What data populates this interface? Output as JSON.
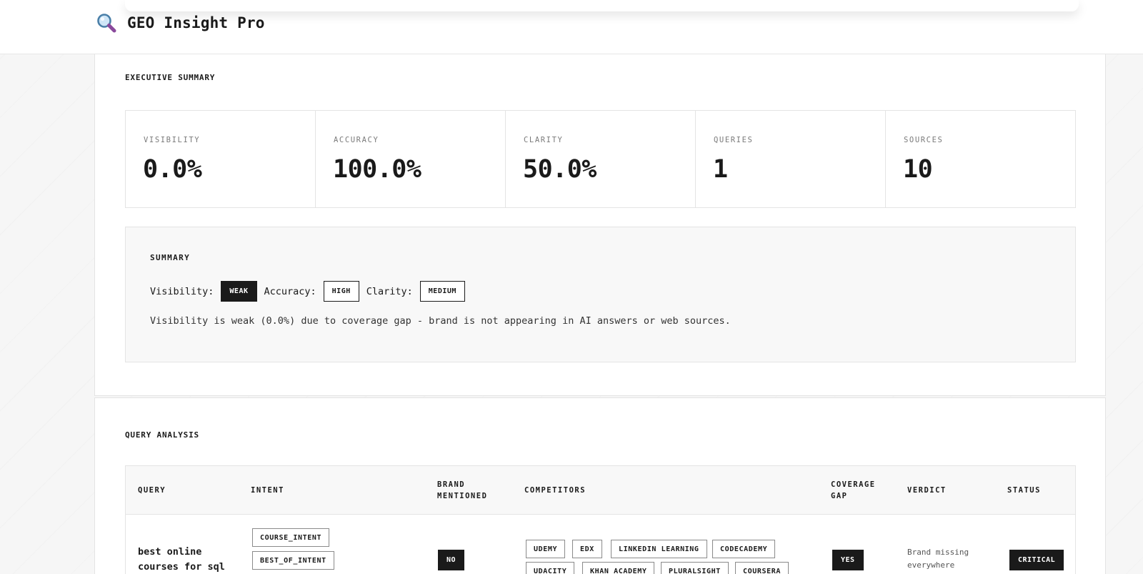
{
  "app": {
    "title": "GEO Insight Pro",
    "logo_icon": "magnifier-icon"
  },
  "executive_summary": {
    "title": "EXECUTIVE SUMMARY",
    "metrics": [
      {
        "label": "VISIBILITY",
        "value": "0.0%"
      },
      {
        "label": "ACCURACY",
        "value": "100.0%"
      },
      {
        "label": "CLARITY",
        "value": "50.0%"
      },
      {
        "label": "QUERIES",
        "value": "1"
      },
      {
        "label": "SOURCES",
        "value": "10"
      }
    ],
    "summary": {
      "title": "SUMMARY",
      "visibility_label": "Visibility:",
      "visibility_value": "WEAK",
      "accuracy_label": "Accuracy:",
      "accuracy_value": "HIGH",
      "clarity_label": "Clarity:",
      "clarity_value": "MEDIUM",
      "text": "Visibility is weak (0.0%) due to coverage gap - brand is not appearing in AI answers or web sources."
    }
  },
  "query_analysis": {
    "title": "QUERY ANALYSIS",
    "headers": {
      "query": "QUERY",
      "intent": "INTENT",
      "brand_mentioned_1": "BRAND",
      "brand_mentioned_2": "MENTIONED",
      "competitors": "COMPETITORS",
      "coverage_gap_1": "COVERAGE",
      "coverage_gap_2": "GAP",
      "verdict": "VERDICT",
      "status": "STATUS"
    },
    "rows": [
      {
        "query": "best online courses for sql",
        "intents": [
          "COURSE_INTENT",
          "BEST_OF_INTENT"
        ],
        "brand_mentioned": "NO",
        "competitors": [
          "UDEMY",
          "EDX",
          "LINKEDIN LEARNING",
          "CODECADEMY",
          "UDACITY",
          "KHAN ACADEMY",
          "PLURALSIGHT",
          "COURSERA"
        ],
        "coverage_gap": "YES",
        "verdict": "Brand missing everywhere",
        "status": "CRITICAL"
      }
    ]
  }
}
